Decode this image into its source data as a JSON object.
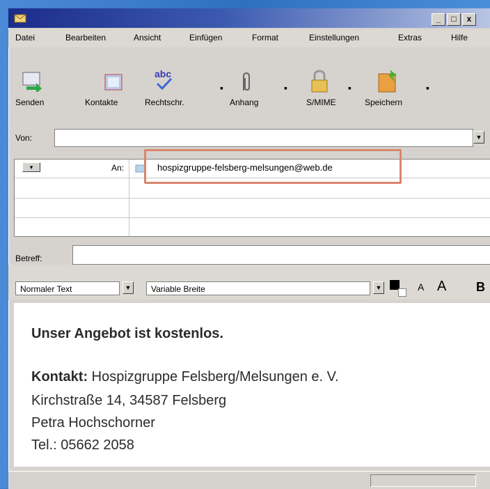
{
  "window": {
    "minimize": "_",
    "maximize": "□",
    "close": "x"
  },
  "menu": [
    "Datei",
    "Bearbeiten",
    "Ansicht",
    "Einfügen",
    "Format",
    "Einstellungen",
    "Extras",
    "Hilfe"
  ],
  "toolbar": [
    "Senden",
    "Kontakte",
    "Rechtschr.",
    "Anhang",
    "S/MIME",
    "Speichern"
  ],
  "toolbar_abc": "abc",
  "from_label": "Von:",
  "to_label": "An:",
  "to_address": "hospizgruppe-felsberg-melsungen@web.de",
  "subject_label": "Betreff:",
  "format": {
    "style": "Normaler Text",
    "font": "Variable Breite",
    "smaller": "A",
    "larger": "A",
    "bold": "B"
  },
  "message": {
    "line1": "Unser Angebot ist kostenlos.",
    "contact_label": "Kontakt:",
    "contact_name": "Hospizgruppe Felsberg/Melsungen e. V.",
    "address": "Kirchstraße 14, 34587 Felsberg",
    "person": "Petra Hochschorner",
    "phone": "Tel.: 05662 2058"
  }
}
